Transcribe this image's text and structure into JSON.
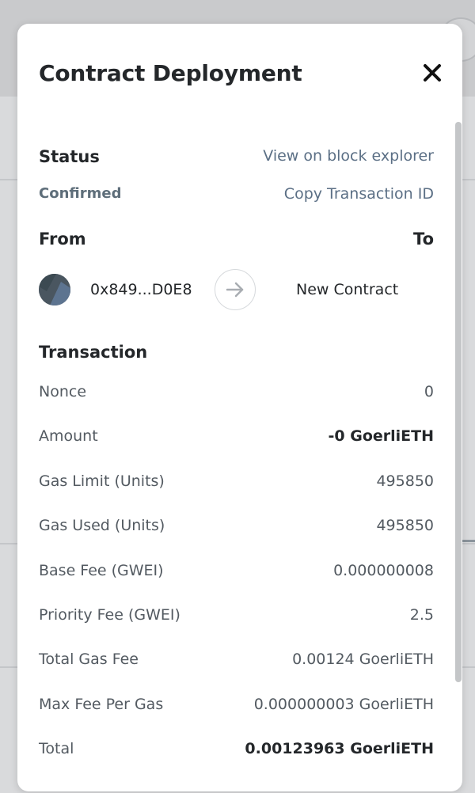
{
  "modal": {
    "title": "Contract Deployment"
  },
  "status": {
    "heading": "Status",
    "value": "Confirmed",
    "view_explorer_link": "View on block explorer",
    "copy_tx_link": "Copy Transaction ID"
  },
  "parties": {
    "from_heading": "From",
    "to_heading": "To",
    "from_address": "0x849...D0E8",
    "to_label": "New Contract"
  },
  "transaction": {
    "heading": "Transaction",
    "rows": [
      {
        "label": "Nonce",
        "value": "0"
      },
      {
        "label": "Amount",
        "value": "-0 GoerliETH"
      },
      {
        "label": "Gas Limit (Units)",
        "value": "495850"
      },
      {
        "label": "Gas Used (Units)",
        "value": "495850"
      },
      {
        "label": "Base Fee (GWEI)",
        "value": "0.000000008"
      },
      {
        "label": "Priority Fee (GWEI)",
        "value": "2.5"
      },
      {
        "label": "Total Gas Fee",
        "value": "0.00124 GoerliETH"
      },
      {
        "label": "Max Fee Per Gas",
        "value": "0.000000003 GoerliETH"
      },
      {
        "label": "Total",
        "value": "0.00123963 GoerliETH"
      }
    ]
  },
  "colors": {
    "text_primary": "#24272a",
    "text_secondary": "#535a61",
    "link": "#5b6f85",
    "status_confirmed": "#5e6e7a"
  },
  "icons": {
    "close": "close-icon",
    "arrow": "arrow-right-icon",
    "avatar": "account-avatar"
  }
}
